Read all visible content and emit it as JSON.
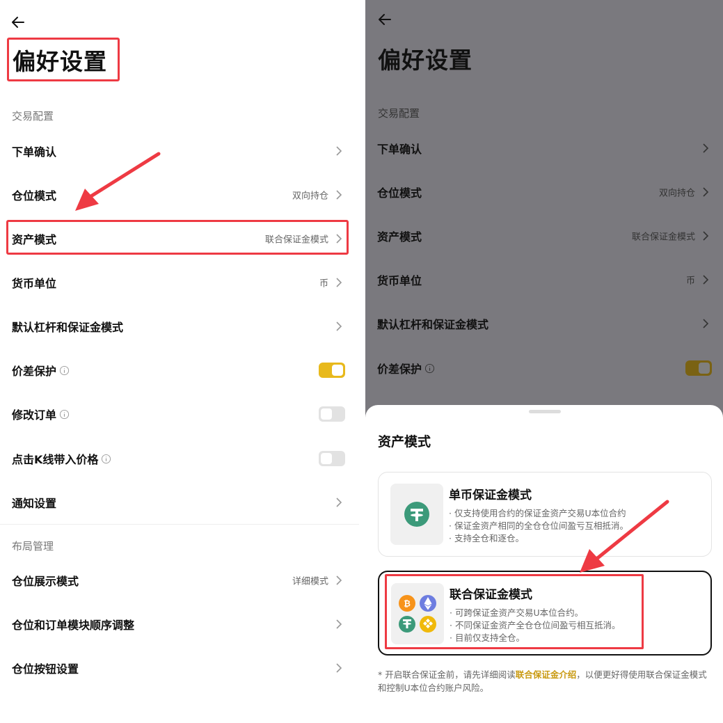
{
  "left": {
    "title": "偏好设置",
    "section_trade": "交易配置",
    "section_layout": "布局管理",
    "rows": [
      {
        "label": "下单确认",
        "value": ""
      },
      {
        "label": "仓位模式",
        "value": "双向持仓"
      },
      {
        "label": "资产模式",
        "value": "联合保证金模式"
      },
      {
        "label": "货币单位",
        "value": "币"
      },
      {
        "label": "默认杠杆和保证金模式",
        "value": ""
      },
      {
        "label": "价差保护",
        "toggle": "on"
      },
      {
        "label": "修改订单",
        "toggle": "off"
      },
      {
        "label": "点击K线带入价格",
        "toggle": "off"
      },
      {
        "label": "通知设置",
        "value": ""
      },
      {
        "label": "仓位展示模式",
        "value": "详细模式"
      },
      {
        "label": "仓位和订单模块顺序调整",
        "value": ""
      },
      {
        "label": "仓位按钮设置",
        "value": ""
      }
    ]
  },
  "right": {
    "title": "偏好设置",
    "section_trade": "交易配置",
    "rows": [
      {
        "label": "下单确认",
        "value": ""
      },
      {
        "label": "仓位模式",
        "value": "双向持仓"
      },
      {
        "label": "资产模式",
        "value": "联合保证金模式"
      },
      {
        "label": "货币单位",
        "value": "币"
      },
      {
        "label": "默认杠杆和保证金模式",
        "value": ""
      },
      {
        "label": "价差保护",
        "toggle": "on"
      }
    ],
    "sheet": {
      "title": "资产模式",
      "single": {
        "title": "单币保证金模式",
        "bullets": [
          "· 仅支持使用合约的保证金资产交易U本位合约",
          "· 保证金资产相同的全仓仓位间盈亏互相抵消。",
          "· 支持全仓和逐仓。"
        ]
      },
      "multi": {
        "title": "联合保证金模式",
        "bullets": [
          "· 可跨保证金资产交易U本位合约。",
          "· 不同保证金资产全仓仓位间盈亏相互抵消。",
          "· 目前仅支持全仓。"
        ]
      },
      "note_prefix": "* 开启联合保证金前，请先详细阅读",
      "note_link": "联合保证金介绍",
      "note_suffix": "，以便更好得使用联合保证金模式和控制U本位合约账户风险。"
    }
  },
  "colors": {
    "accent_yellow": "#e8b91c",
    "highlight_red": "#ee3a43",
    "tether_green": "#3c9a7a",
    "bitcoin_orange": "#f7931a",
    "eth_purple": "#6d7de0",
    "bnb_yellow": "#f0b90b"
  }
}
